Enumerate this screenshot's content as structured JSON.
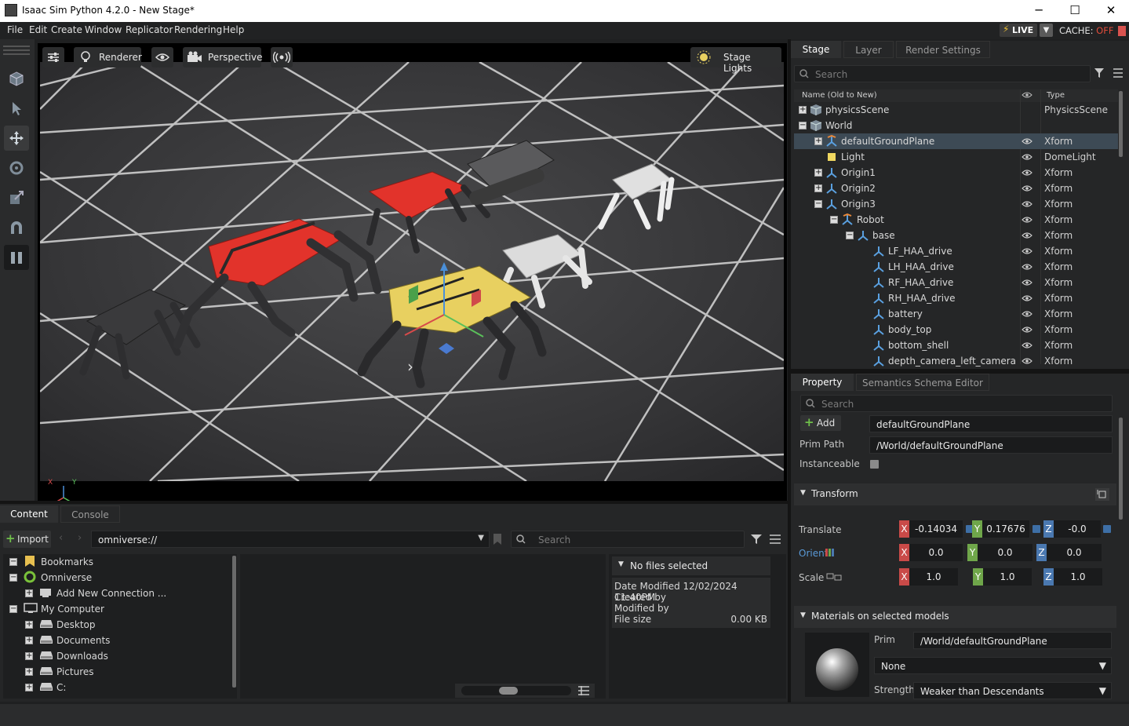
{
  "window": {
    "title": "Isaac Sim Python 4.2.0 - New Stage*",
    "minimize": "─",
    "maximize": "☐",
    "close": "✕"
  },
  "menu": [
    "File",
    "Edit",
    "Create",
    "Window",
    "Replicator",
    "Rendering",
    "Help"
  ],
  "live": {
    "label": "LIVE",
    "cache_label": "CACHE:",
    "cache_state": "OFF"
  },
  "viewport": {
    "renderer_label": "Renderer",
    "camera_label": "Perspective",
    "lights_label": "Stage Lights",
    "axis_x": "X",
    "axis_y": "Y"
  },
  "stage": {
    "tabs": [
      "Stage",
      "Layer",
      "Render Settings"
    ],
    "search_placeholder": "Search",
    "col_name": "Name (Old to New)",
    "col_type": "Type",
    "rows": [
      {
        "name": "physicsScene",
        "type": "PhysicsScene"
      },
      {
        "name": "World",
        "type": ""
      },
      {
        "name": "defaultGroundPlane",
        "type": "Xform"
      },
      {
        "name": "Light",
        "type": "DomeLight"
      },
      {
        "name": "Origin1",
        "type": "Xform"
      },
      {
        "name": "Origin2",
        "type": "Xform"
      },
      {
        "name": "Origin3",
        "type": "Xform"
      },
      {
        "name": "Robot",
        "type": "Xform"
      },
      {
        "name": "base",
        "type": "Xform"
      },
      {
        "name": "LF_HAA_drive",
        "type": "Xform"
      },
      {
        "name": "LH_HAA_drive",
        "type": "Xform"
      },
      {
        "name": "RF_HAA_drive",
        "type": "Xform"
      },
      {
        "name": "RH_HAA_drive",
        "type": "Xform"
      },
      {
        "name": "battery",
        "type": "Xform"
      },
      {
        "name": "body_top",
        "type": "Xform"
      },
      {
        "name": "bottom_shell",
        "type": "Xform"
      },
      {
        "name": "depth_camera_left_camera",
        "type": "Xform"
      }
    ]
  },
  "property": {
    "tabs": [
      "Property",
      "Semantics Schema Editor"
    ],
    "search_placeholder": "Search",
    "add_label": "Add",
    "prim_name": "defaultGroundPlane",
    "prim_path_label": "Prim Path",
    "prim_path": "/World/defaultGroundPlane",
    "instanceable_label": "Instanceable",
    "transform_label": "Transform",
    "translate_label": "Translate",
    "orient_label": "Orient",
    "scale_label": "Scale",
    "translate": {
      "x": "-0.14034",
      "y": "0.17676",
      "z": "-0.0"
    },
    "orient": {
      "x": "0.0",
      "y": "0.0",
      "z": "0.0"
    },
    "scale": {
      "x": "1.0",
      "y": "1.0",
      "z": "1.0"
    },
    "axis": {
      "x": "X",
      "y": "Y",
      "z": "Z"
    },
    "materials_label": "Materials on selected models",
    "prim_label": "Prim",
    "material_prim": "/World/defaultGroundPlane",
    "material_value": "None",
    "strength_label": "Strength",
    "strength_value": "Weaker than Descendants"
  },
  "content": {
    "tabs": [
      "Content",
      "Console"
    ],
    "import_label": "Import",
    "path": "omniverse://",
    "search_placeholder": "Search",
    "tree": [
      {
        "name": "Bookmarks"
      },
      {
        "name": "Omniverse"
      },
      {
        "name": "Add New Connection ..."
      },
      {
        "name": "My Computer"
      },
      {
        "name": "Desktop"
      },
      {
        "name": "Documents"
      },
      {
        "name": "Downloads"
      },
      {
        "name": "Pictures"
      },
      {
        "name": "C:"
      }
    ],
    "details": {
      "header": "No files selected",
      "date_modified": "Date Modified 12/02/2024 11:40PM",
      "created_by": "Created by",
      "modified_by": "Modified by",
      "file_size_label": "File size",
      "file_size": "0.00 KB"
    }
  },
  "colors": {
    "accent": "#3d4a55",
    "axis_x": "#c94a48",
    "axis_y": "#6fa64a",
    "axis_z": "#4a78b0",
    "robot_red": "#e2332b",
    "robot_yellow": "#e8d060"
  }
}
